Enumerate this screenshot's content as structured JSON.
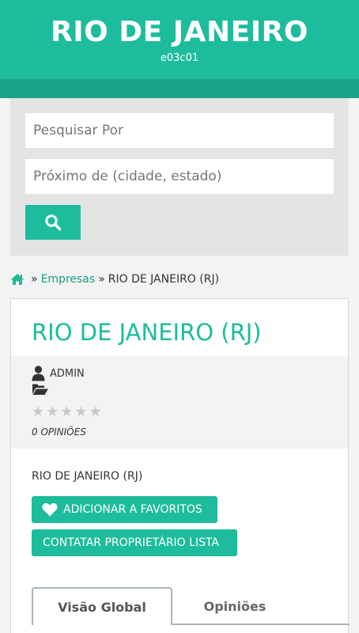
{
  "header": {
    "title": "RIO DE JANEIRO",
    "subtitle": "e03c01"
  },
  "search": {
    "query_placeholder": "Pesquisar Por",
    "location_placeholder": "Próximo de (cidade, estado)",
    "button_icon": "search-icon"
  },
  "breadcrumb": {
    "home_icon": "home-icon",
    "separator": "»",
    "link": "Empresas",
    "current": "RIO DE JANEIRO (RJ)"
  },
  "listing": {
    "title": "RIO DE JANEIRO (RJ)",
    "author": "ADMIN",
    "rating": 0,
    "rating_max": 5,
    "reviews_label": "0 OPINIÕES",
    "company_name": "RIO DE JANEIRO (RJ)",
    "favorite_button": "ADICIONAR A FAVORITOS",
    "contact_button": "CONTATAR PROPRIETÁRIO LISTA"
  },
  "tabs": [
    {
      "label": "Visão Global",
      "active": true
    },
    {
      "label": "Opiniões",
      "active": false
    }
  ],
  "colors": {
    "accent": "#1dbc9c",
    "accent_dark": "#17a488",
    "star_empty": "#c8c8c8"
  }
}
